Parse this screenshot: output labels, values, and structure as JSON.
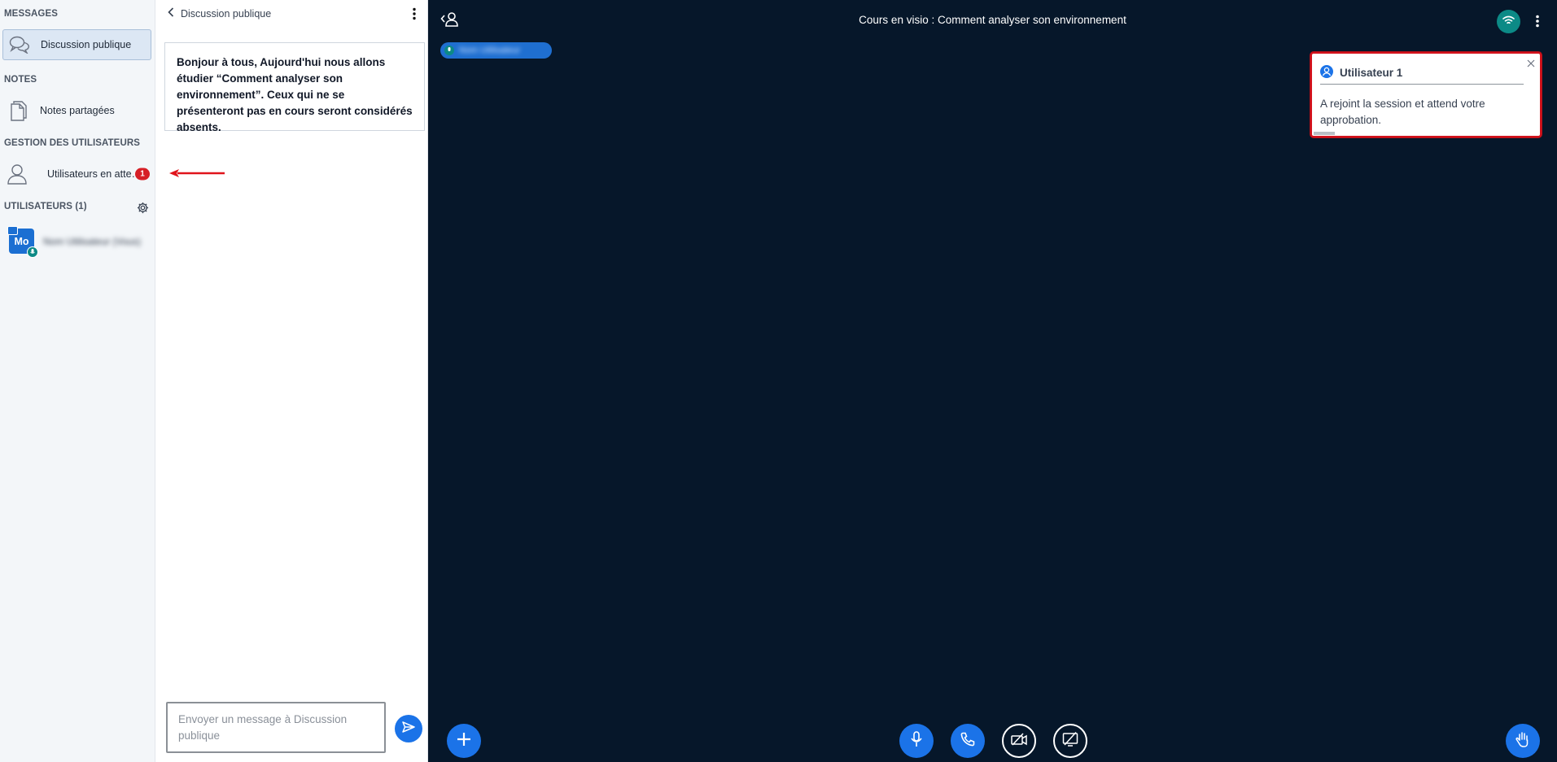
{
  "sidebar": {
    "messages_title": "MESSAGES",
    "public_chat_label": "Discussion publique",
    "notes_title": "NOTES",
    "shared_notes_label": "Notes partagées",
    "user_mgmt_title": "GESTION DES UTILISATEURS",
    "waiting_users_label": "Utilisateurs en atte…",
    "waiting_users_count": "1",
    "users_title": "UTILISATEURS (1)",
    "user_avatar_initials": "Mo",
    "user_name": "Nom Utilisateur (Vous)"
  },
  "chat": {
    "header": "Discussion publique",
    "welcome_message": "Bonjour à tous,  Aujourd'hui nous allons étudier “Comment analyser son environnement”.  Ceux qui ne se présenteront pas en cours seront considérés absents.",
    "input_placeholder": "Envoyer un message à Discussion publique"
  },
  "main": {
    "title": "Cours en visio : Comment analyser son environnement",
    "talking_user": "Nom Utilisateur"
  },
  "notification": {
    "user": "Utilisateur 1",
    "message": "A rejoint la session et attend votre approbation."
  },
  "colors": {
    "main_bg": "#06172a",
    "accent": "#1b73e8",
    "badge": "#d61f26",
    "connection": "#0c8a86"
  }
}
